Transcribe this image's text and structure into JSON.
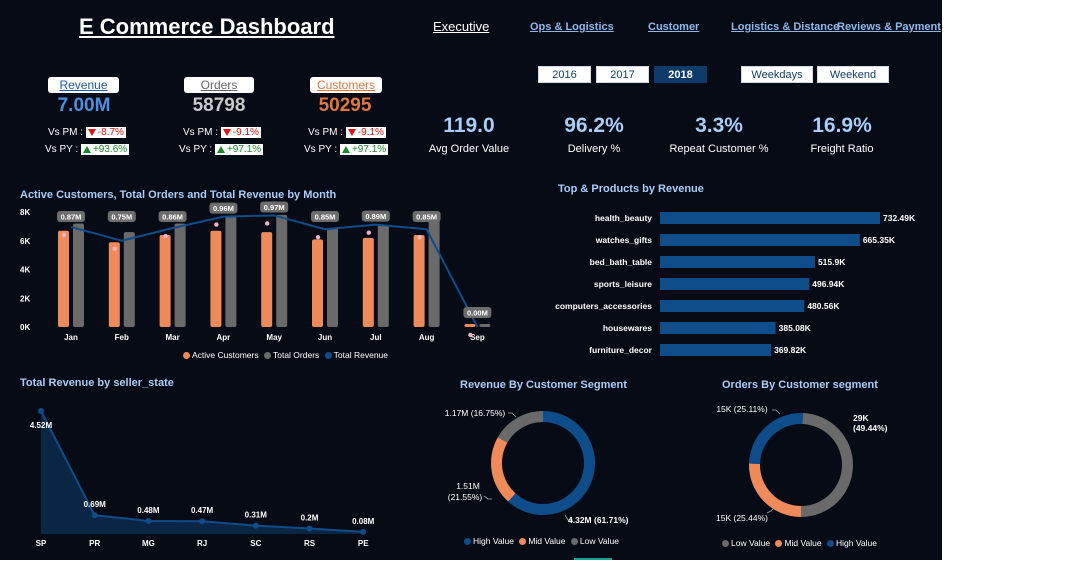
{
  "title": "E Commerce Dashboard",
  "nav": [
    {
      "label": "Executive",
      "active": true
    },
    {
      "label": "Ops & Logistics",
      "active": false
    },
    {
      "label": "Customer",
      "active": false
    },
    {
      "label": "Logistics & Distance",
      "active": false
    },
    {
      "label": "Reviews & Payment",
      "active": false
    }
  ],
  "kpis": [
    {
      "label": "Revenue",
      "value": "7.00M",
      "label_color": "#1d5aa8",
      "value_color": "#4f8fe0",
      "pm_label": "Vs PM :",
      "pm_value": "-8.7%",
      "py_label": "Vs PY :",
      "py_value": "+93.6%"
    },
    {
      "label": "Orders",
      "value": "58798",
      "label_color": "#666666",
      "value_color": "#c9c9c9",
      "pm_label": "Vs PM :",
      "pm_value": "-9.1%",
      "py_label": "Vs PY :",
      "py_value": "+97.1%"
    },
    {
      "label": "Customers",
      "value": "50295",
      "label_color": "#e0773f",
      "value_color": "#e0773f",
      "pm_label": "Vs PM :",
      "pm_value": "-9.1%",
      "py_label": "Vs PY :",
      "py_value": "+97.1%"
    }
  ],
  "year_filters": [
    {
      "label": "2016",
      "selected": false
    },
    {
      "label": "2017",
      "selected": false
    },
    {
      "label": "2018",
      "selected": true
    }
  ],
  "day_filters": [
    {
      "label": "Weekdays"
    },
    {
      "label": "Weekend"
    }
  ],
  "metrics": [
    {
      "value": "119.0",
      "label": "Avg Order Value"
    },
    {
      "value": "96.2%",
      "label": "Delivery %"
    },
    {
      "value": "3.3%",
      "label": "Repeat Customer %"
    },
    {
      "value": "16.9%",
      "label": "Freight Ratio"
    }
  ],
  "colors": {
    "customers": "#ef8a5a",
    "orders": "#6a6a6a",
    "revenue": "#0f4d8a",
    "accent": "#a9cdf7"
  },
  "chart_data": [
    {
      "type": "bar",
      "title": "Active Customers, Total Orders and Total Revenue by Month",
      "categories": [
        "Jan",
        "Feb",
        "Mar",
        "Apr",
        "May",
        "Jun",
        "Jul",
        "Aug",
        "Sep"
      ],
      "y_ticks": [
        "0K",
        "2K",
        "4K",
        "6K",
        "8K"
      ],
      "ylim": [
        0,
        8000
      ],
      "series": [
        {
          "name": "Active Customers",
          "type": "bar",
          "values": [
            6700,
            5900,
            6400,
            6700,
            6600,
            6100,
            6200,
            6400,
            16
          ]
        },
        {
          "name": "Total Orders",
          "type": "bar",
          "values": [
            7200,
            6600,
            7200,
            7700,
            7800,
            6900,
            7100,
            7600,
            16
          ]
        },
        {
          "name": "Total Revenue",
          "type": "line",
          "values": [
            0.87,
            0.75,
            0.86,
            0.96,
            0.97,
            0.85,
            0.89,
            0.85,
            0.0
          ],
          "labels": [
            "0.87M",
            "0.75M",
            "0.86M",
            "0.96M",
            "0.97M",
            "0.85M",
            "0.89M",
            "0.85M",
            "0.00M"
          ]
        }
      ],
      "legend": [
        "Active Customers",
        "Total Orders",
        "Total Revenue"
      ],
      "legend_position": "bottom"
    },
    {
      "type": "bar",
      "orientation": "horizontal",
      "title": "Top & Products by Revenue",
      "categories": [
        "health_beauty",
        "watches_gifts",
        "bed_bath_table",
        "sports_leisure",
        "computers_accessories",
        "housewares",
        "furniture_decor"
      ],
      "values": [
        732.49,
        665.35,
        515.9,
        496.94,
        480.56,
        385.08,
        369.82
      ],
      "labels": [
        "732.49K",
        "665.35K",
        "515.9K",
        "496.94K",
        "480.56K",
        "385.08K",
        "369.82K"
      ],
      "xlim": [
        0,
        732.49
      ]
    },
    {
      "type": "area",
      "title": "Total Revenue by seller_state",
      "categories": [
        "SP",
        "PR",
        "MG",
        "RJ",
        "SC",
        "RS",
        "PE"
      ],
      "values": [
        4.52,
        0.69,
        0.48,
        0.47,
        0.31,
        0.2,
        0.08
      ],
      "labels": [
        "4.52M",
        "0.69M",
        "0.48M",
        "0.47M",
        "0.31M",
        "0.2M",
        "0.08M"
      ]
    },
    {
      "type": "pie",
      "donut": true,
      "title": "Revenue By Customer Segment",
      "slices": [
        {
          "name": "High Value",
          "value": 4.32,
          "percent": 61.71,
          "label": "4.32M (61.71%)"
        },
        {
          "name": "Mid Value",
          "value": 1.51,
          "percent": 21.55,
          "label_line1": "1.51M",
          "label_line2": "(21.55%)"
        },
        {
          "name": "Low Value",
          "value": 1.17,
          "percent": 16.75,
          "label": "1.17M (16.75%)"
        }
      ],
      "legend": [
        "High Value",
        "Mid Value",
        "Low Value"
      ]
    },
    {
      "type": "pie",
      "donut": true,
      "title": "Orders By Customer segment",
      "slices": [
        {
          "name": "Low Value",
          "value": 29,
          "percent": 49.44,
          "label_line1": "29K",
          "label_line2": "(49.44%)"
        },
        {
          "name": "Mid Value",
          "value": 15,
          "percent": 25.44,
          "label": "15K (25.44%)"
        },
        {
          "name": "High Value",
          "value": 15,
          "percent": 25.11,
          "label": "15K (25.11%)"
        }
      ],
      "legend": [
        "Low Value",
        "Mid Value",
        "High Value"
      ]
    }
  ]
}
